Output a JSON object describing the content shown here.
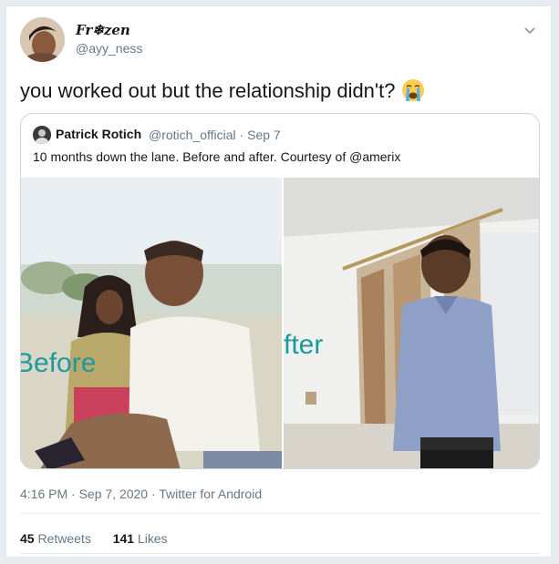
{
  "tweet": {
    "display_name": "Fr❄zen",
    "handle": "@ayy_ness",
    "text": "you worked out but the relationship didn't?",
    "emoji_icon": "loudly-crying-face-icon",
    "timestamp": "4:16 PM · Sep 7, 2020 · Twitter for Android",
    "retweets_count": "45",
    "retweets_label": " Retweets",
    "likes_count": "141",
    "likes_label": " Likes"
  },
  "quoted": {
    "name": "Patrick Rotich",
    "handle_date": "@rotich_official · Sep 7",
    "text": "10 months down the lane. Before and after. Courtesy of @amerix",
    "left_image_caption": "Before",
    "right_image_caption": "fter"
  },
  "colors": {
    "secondary_text": "#657786",
    "caption_teal": "#1a9aa0"
  }
}
